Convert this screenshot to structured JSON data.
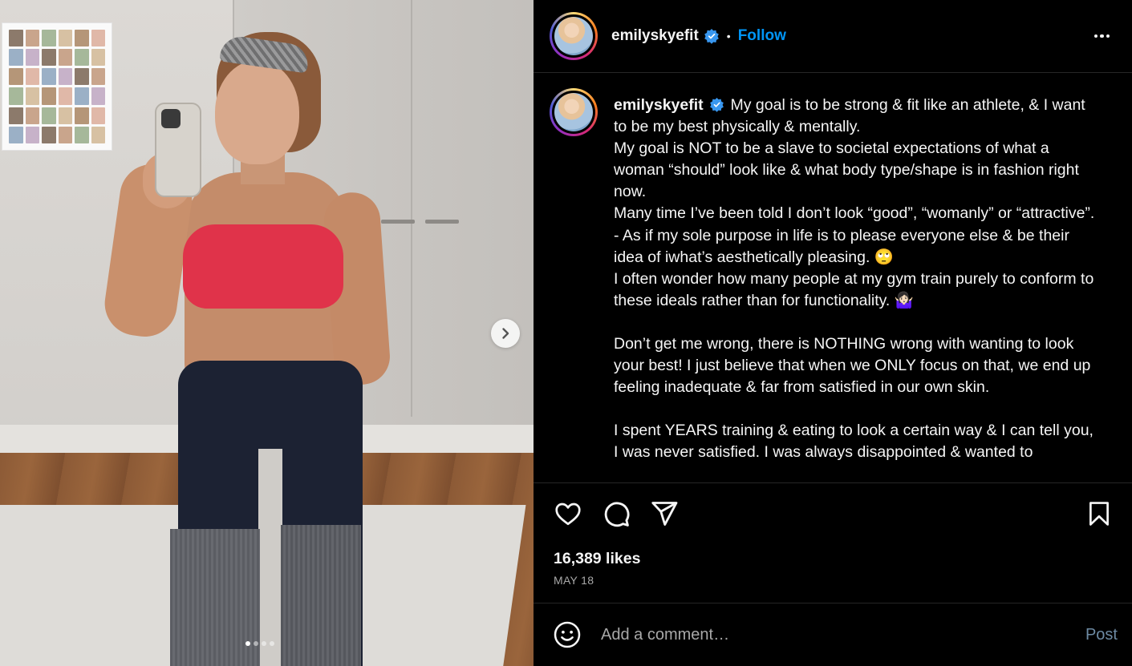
{
  "post": {
    "username": "emilyskyefit",
    "verified": true,
    "separator": "•",
    "follow_label": "Follow",
    "more_options_icon": "more-horizontal-icon",
    "photo_carousel": {
      "current_index": 1,
      "total": 4
    },
    "caption": {
      "username": "emilyskyefit",
      "paragraphs": [
        "My goal is to be strong & fit like an athlete, & I want to be my best physically & mentally.\nMy goal is NOT to be a slave to societal expectations of what a woman “should” look like & what body type/shape is in fashion right now.\nMany time I’ve been told I don’t look “good”, “womanly” or “attractive”. - As if my sole purpose in life is to please everyone else & be their idea of iwhat’s aesthetically pleasing. 🙄\nI often wonder how many people at my gym train purely to conform to these ideals rather than for functionality. 🤷🏻‍♀️",
        "Don’t get me wrong, there is NOTHING wrong with wanting to look your best! I just believe that when we ONLY focus on that, we end up feeling inadequate & far from satisfied in our own skin.",
        "I spent YEARS training & eating to look a certain way & I can tell you, I was never satisfied. I was always disappointed & wanted to"
      ]
    },
    "likes": "16,389 likes",
    "date": "MAY 18",
    "comment": {
      "placeholder": "Add a comment…",
      "post_label": "Post"
    },
    "colors": {
      "background": "#000000",
      "text": "#f5f5f5",
      "follow": "#0095f6",
      "muted": "#a8a8a8",
      "verified": "#3897f0"
    }
  }
}
